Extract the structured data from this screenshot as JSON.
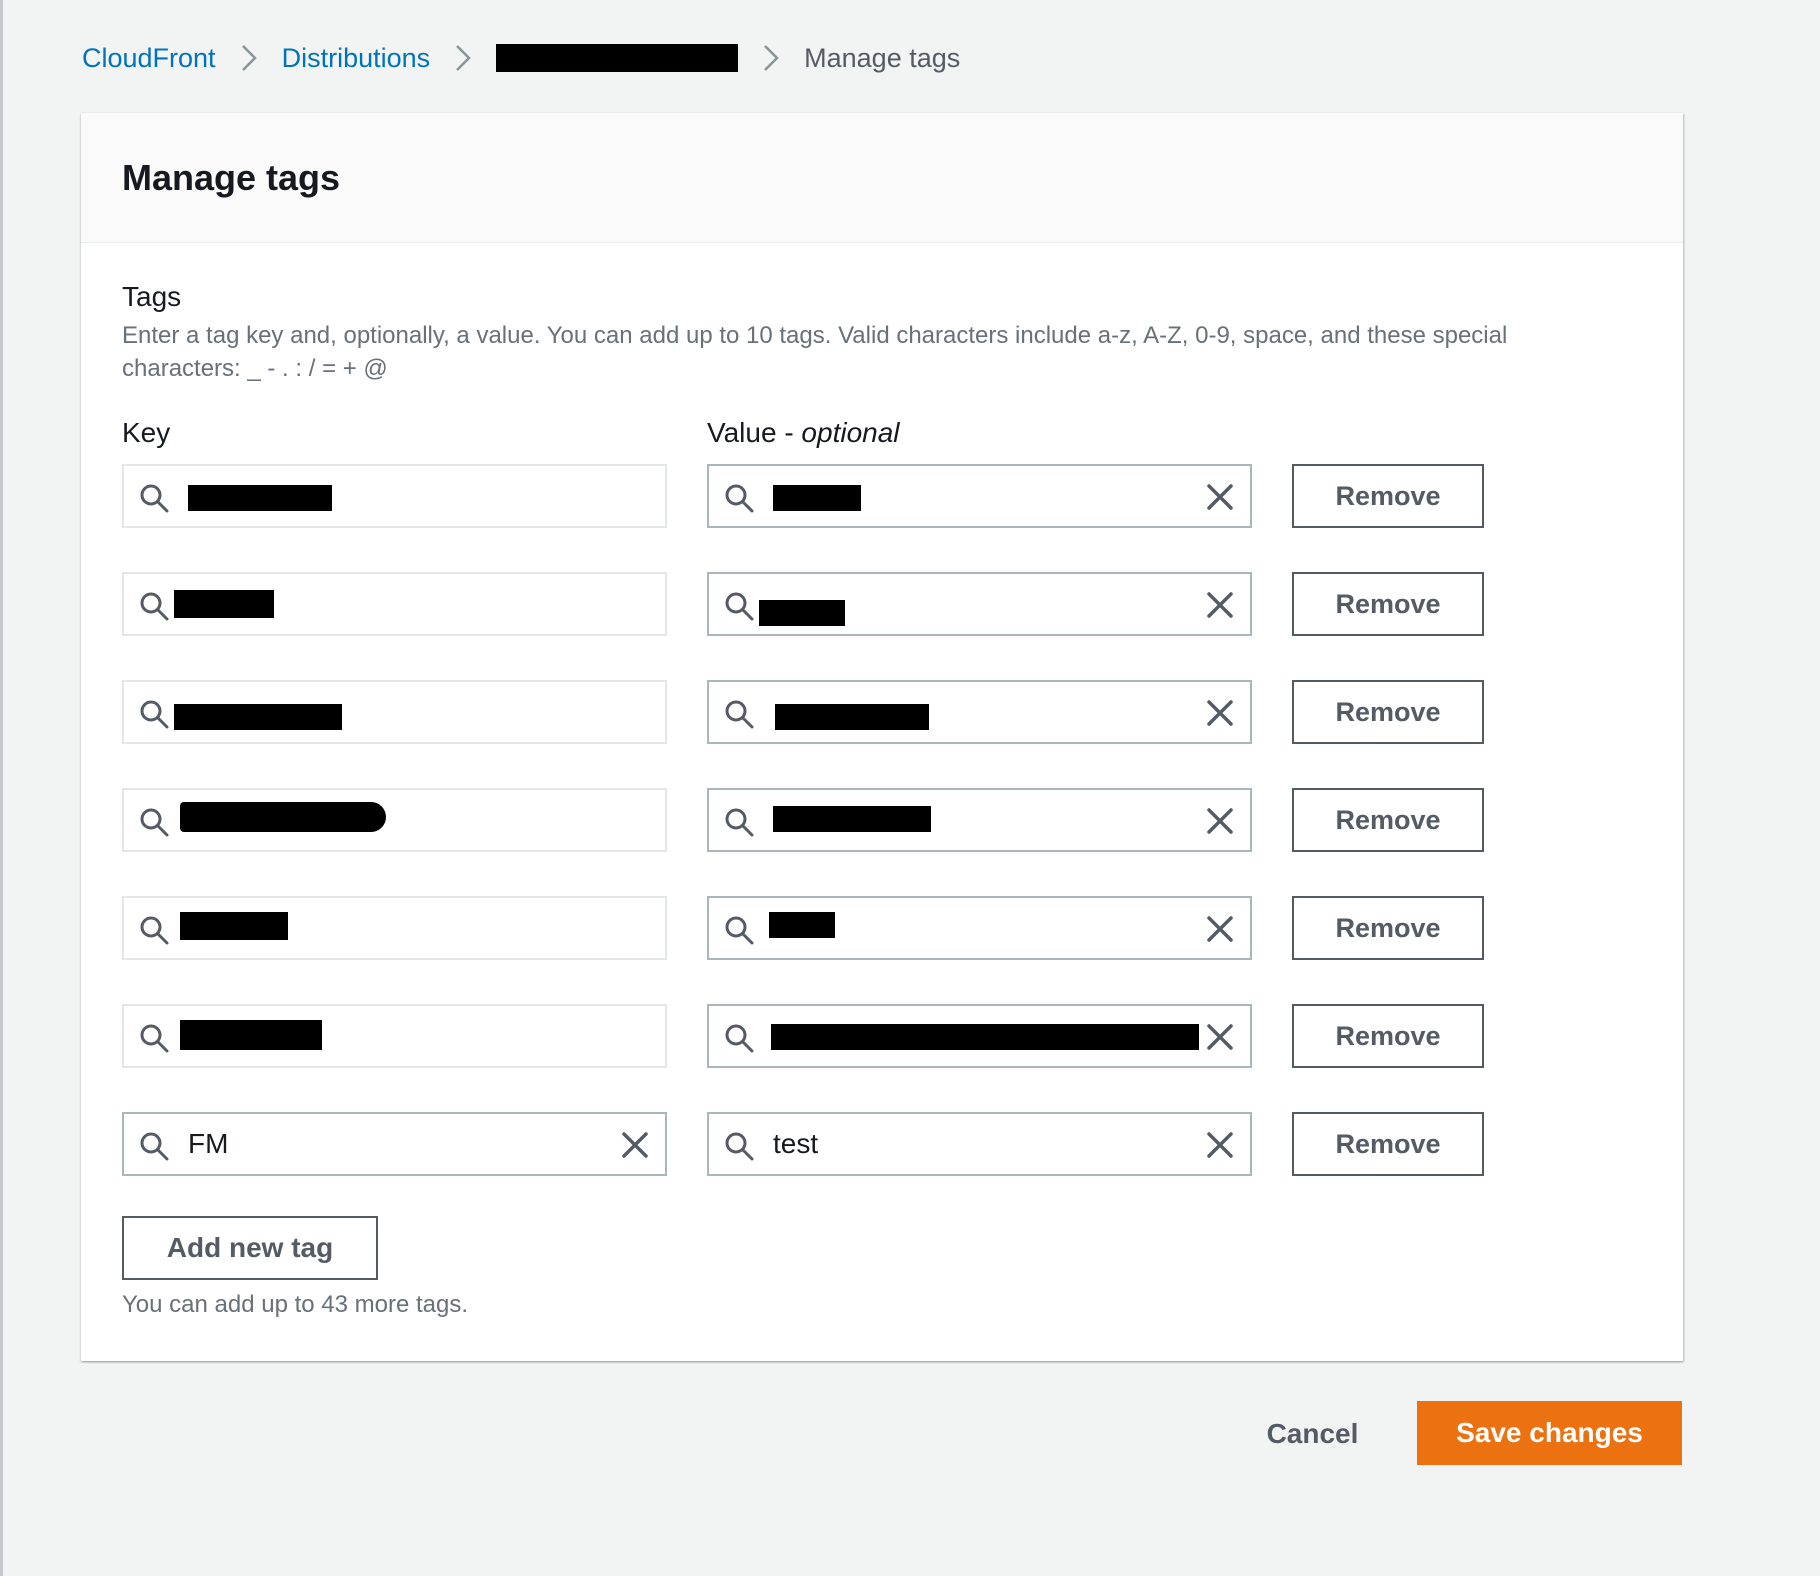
{
  "breadcrumb": {
    "items": [
      "CloudFront",
      "Distributions",
      "Manage tags"
    ],
    "separator_icon": "chevron-right-icon"
  },
  "panel": {
    "title": "Manage tags",
    "tags_label": "Tags",
    "description": "Enter a tag key and, optionally, a value. You can add up to 10 tags. Valid characters include a-z, A-Z, 0-9, space, and these special characters: _ - . : / = + @",
    "key_label": "Key",
    "value_label_main": "Value - ",
    "value_label_optional": "optional"
  },
  "tags": [
    {
      "key": "[redacted]",
      "value": "[redacted]",
      "remove_label": "Remove"
    },
    {
      "key": "[redacted]",
      "value": "[redacted]",
      "remove_label": "Remove"
    },
    {
      "key": "[redacted]",
      "value": "[redacted]",
      "remove_label": "Remove"
    },
    {
      "key": "[redacted]",
      "value": "[redacted]",
      "remove_label": "Remove"
    },
    {
      "key": "[redacted]",
      "value": "[redacted]",
      "remove_label": "Remove"
    },
    {
      "key": "[redacted]",
      "value": "[redacted]",
      "remove_label": "Remove"
    },
    {
      "key": "FM",
      "value": "test",
      "remove_label": "Remove"
    }
  ],
  "add_button_label": "Add new tag",
  "add_hint": "You can add up to 43 more tags.",
  "footer": {
    "cancel_label": "Cancel",
    "save_label": "Save changes"
  },
  "colors": {
    "link": "#0073bb",
    "primary_button": "#ec7211",
    "page_background": "#f2f3f3",
    "border": "#aab7b8"
  },
  "icons": {
    "field_search": "search-icon",
    "field_clear": "close-icon"
  }
}
